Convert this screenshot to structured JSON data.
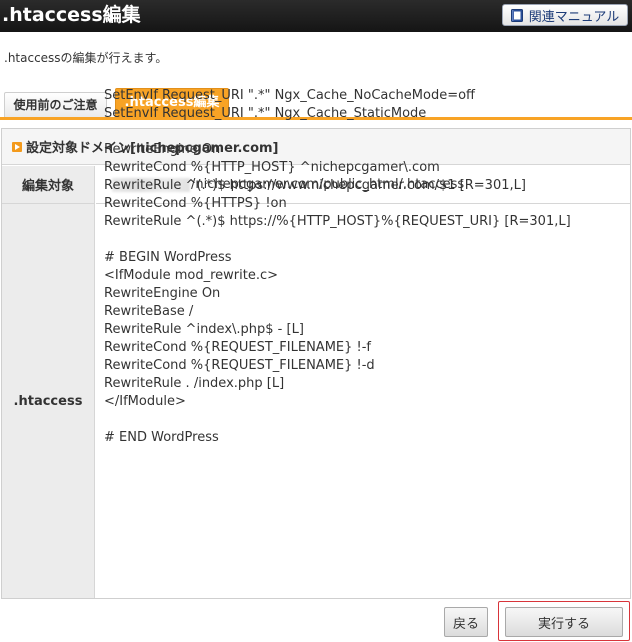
{
  "header": {
    "title": ".htaccess編集",
    "manual_label": "関連マニュアル"
  },
  "description": ".htaccessの編集が行えます。",
  "tabs": [
    {
      "label": "使用前のご注意",
      "active": false
    },
    {
      "label": ".htaccess編集",
      "active": true
    }
  ],
  "panel": {
    "title": "設定対象ドメイン[nichepcgamer.com]",
    "target_label": "編集対象",
    "target_path": "/nichepcgamer.com/public_html/.htaccess",
    "htaccess_label": ".htaccess",
    "htaccess_content": "SetEnvIf Request_URI \".*\" Ngx_Cache_NoCacheMode=off\nSetEnvIf Request_URI \".*\" Ngx_Cache_StaticMode\n\nRewriteEngine On\nRewriteCond %{HTTP_HOST} ^nichepcgamer\\.com\nRewriteRule ^(.*)$ https://www.nichepcgamer.com/$1 [R=301,L]\nRewriteCond %{HTTPS} !on\nRewriteRule ^(.*)$ https://%{HTTP_HOST}%{REQUEST_URI} [R=301,L]\n\n# BEGIN WordPress\n<IfModule mod_rewrite.c>\nRewriteEngine On\nRewriteBase /\nRewriteRule ^index\\.php$ - [L]\nRewriteCond %{REQUEST_FILENAME} !-f\nRewriteCond %{REQUEST_FILENAME} !-d\nRewriteRule . /index.php [L]\n</IfModule>\n\n# END WordPress"
  },
  "buttons": {
    "back_label": "戻る",
    "execute_label": "実行する"
  },
  "colors": {
    "header_bg": "#1f1f1f",
    "accent": "#f8a325",
    "highlight_border": "#d8343a"
  },
  "icons": {
    "manual": "book-icon",
    "section": "arrow-right-icon"
  }
}
